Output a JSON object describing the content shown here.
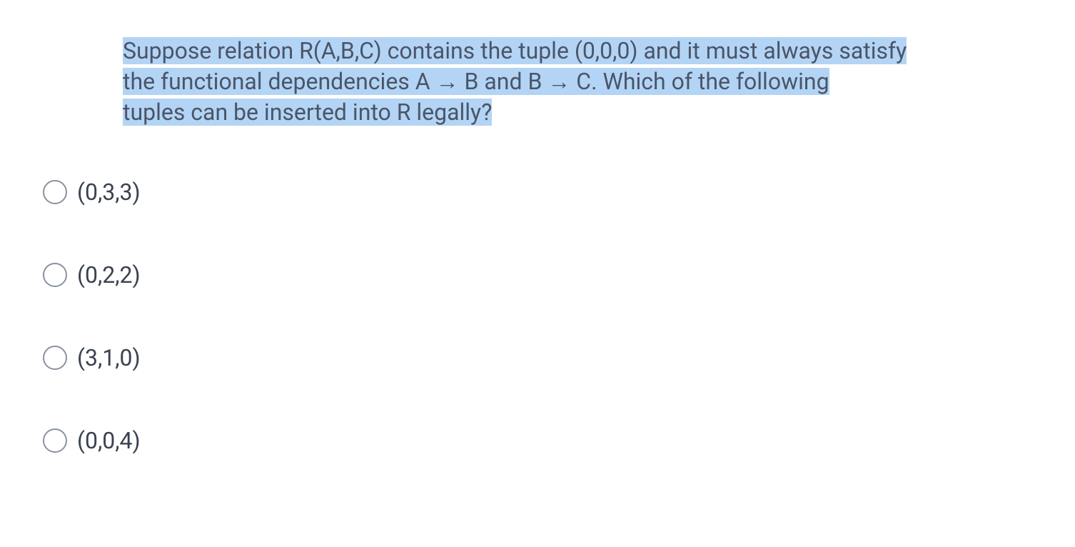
{
  "question": {
    "highlighted_part1": "Suppose relation R(A,B,C) contains the tuple (0,0,0) and it must always satisfy ",
    "highlighted_part2": "the functional dependencies A → B and B → C. Which of the following ",
    "highlighted_part3": "tuples can be inserted into R legally?"
  },
  "options": [
    {
      "label": "(0,3,3)"
    },
    {
      "label": "(0,2,2)"
    },
    {
      "label": "(3,1,0)"
    },
    {
      "label": "(0,0,4)"
    }
  ]
}
